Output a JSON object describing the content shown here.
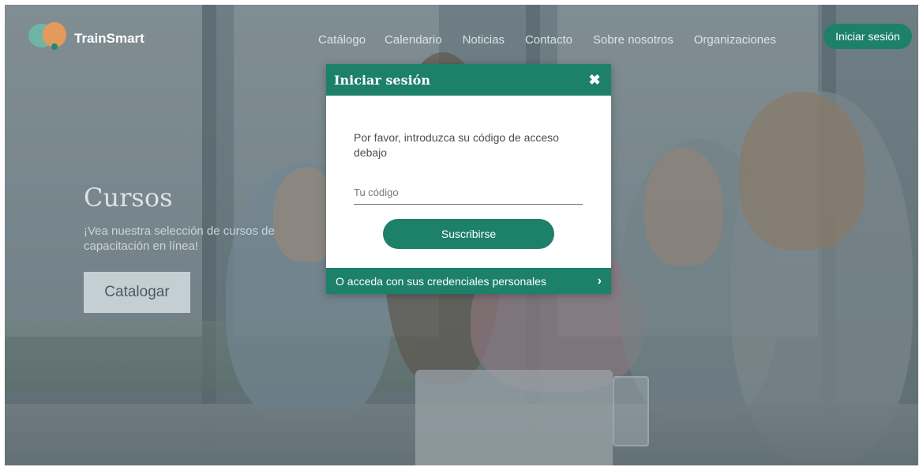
{
  "header": {
    "brand": "TrainSmart",
    "nav": [
      "Catálogo",
      "Calendario",
      "Noticias",
      "Contacto",
      "Sobre nosotros",
      "Organizaciones"
    ],
    "login_label": "Iniciar sesión"
  },
  "hero": {
    "title": "Cursos",
    "subtitle": "¡Vea nuestra selección de cursos de capacitación en línea!",
    "button_label": "Catalogar"
  },
  "modal": {
    "title": "Iniciar sesión",
    "close_icon": "close-icon",
    "instructions": "Por favor, introduzca su código de acceso debajo",
    "code_placeholder": "Tu código",
    "submit_label": "Suscribirse",
    "footer_link": "O acceda con sus credenciales personales",
    "footer_icon": "chevron-right-icon"
  },
  "colors": {
    "accent": "#1d8069",
    "modal_bg": "#ffffff",
    "dim_overlay": "#3c4b50"
  }
}
